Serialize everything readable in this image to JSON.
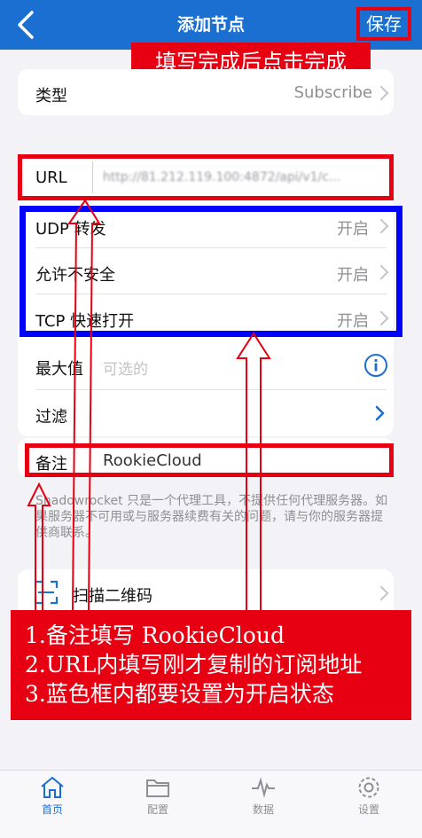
{
  "nav": {
    "title": "添加节点",
    "save_label": "保存"
  },
  "annotation_top": "填写完成后点击完成",
  "type_row": {
    "label": "类型",
    "value": "Subscribe"
  },
  "url_row": {
    "label": "URL",
    "value": "http://81.212.119.100:4872/api/v1/c..."
  },
  "options": [
    {
      "label": "UDP 转发",
      "value": "开启"
    },
    {
      "label": "允许不安全",
      "value": "开启"
    },
    {
      "label": "TCP 快速打开",
      "value": "开启"
    }
  ],
  "max_row": {
    "label": "最大值",
    "placeholder": "可选的"
  },
  "filter_row": {
    "label": "过滤"
  },
  "remark_row": {
    "label": "备注",
    "value": "RookieCloud"
  },
  "disclaimer": "Shadowrocket 只是一个代理工具，不提供任何代理服务器。如果服务器不可用或与服务器续费有关的问题，请与你的服务器提供商联系。",
  "scan_row": {
    "label": "扫描二维码"
  },
  "annotation_bottom": [
    "1.备注填写 RookieCloud",
    "2.URL内填写刚才复制的订阅地址",
    "3.蓝色框内都要设置为开启状态"
  ],
  "tabs": [
    {
      "label": "首页",
      "active": true,
      "icon": "home-icon"
    },
    {
      "label": "配置",
      "active": false,
      "icon": "folder-icon"
    },
    {
      "label": "数据",
      "active": false,
      "icon": "pulse-icon"
    },
    {
      "label": "设置",
      "active": false,
      "icon": "gear-icon"
    }
  ],
  "colors": {
    "nav_blue": "#1a6fd0",
    "annotation_red": "#e60012",
    "highlight_blue": "#0000ff",
    "accent": "#1a6fd0"
  }
}
